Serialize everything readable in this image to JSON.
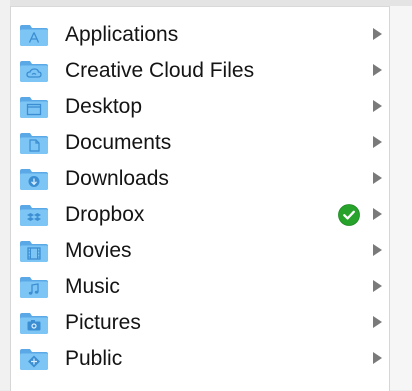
{
  "colors": {
    "folder_back": "#5aa9e6",
    "folder_front": "#7cc5f5",
    "folder_glyph": "#3b8ed2",
    "arrow": "#7a7a7a",
    "badge_green": "#27a22b"
  },
  "items": [
    {
      "label": "Applications",
      "icon": "applications-folder-icon"
    },
    {
      "label": "Creative Cloud Files",
      "icon": "creative-cloud-folder-icon"
    },
    {
      "label": "Desktop",
      "icon": "desktop-folder-icon"
    },
    {
      "label": "Documents",
      "icon": "documents-folder-icon"
    },
    {
      "label": "Downloads",
      "icon": "downloads-folder-icon"
    },
    {
      "label": "Dropbox",
      "icon": "dropbox-folder-icon",
      "sync_status": "synced"
    },
    {
      "label": "Movies",
      "icon": "movies-folder-icon"
    },
    {
      "label": "Music",
      "icon": "music-folder-icon"
    },
    {
      "label": "Pictures",
      "icon": "pictures-folder-icon"
    },
    {
      "label": "Public",
      "icon": "public-folder-icon"
    }
  ]
}
